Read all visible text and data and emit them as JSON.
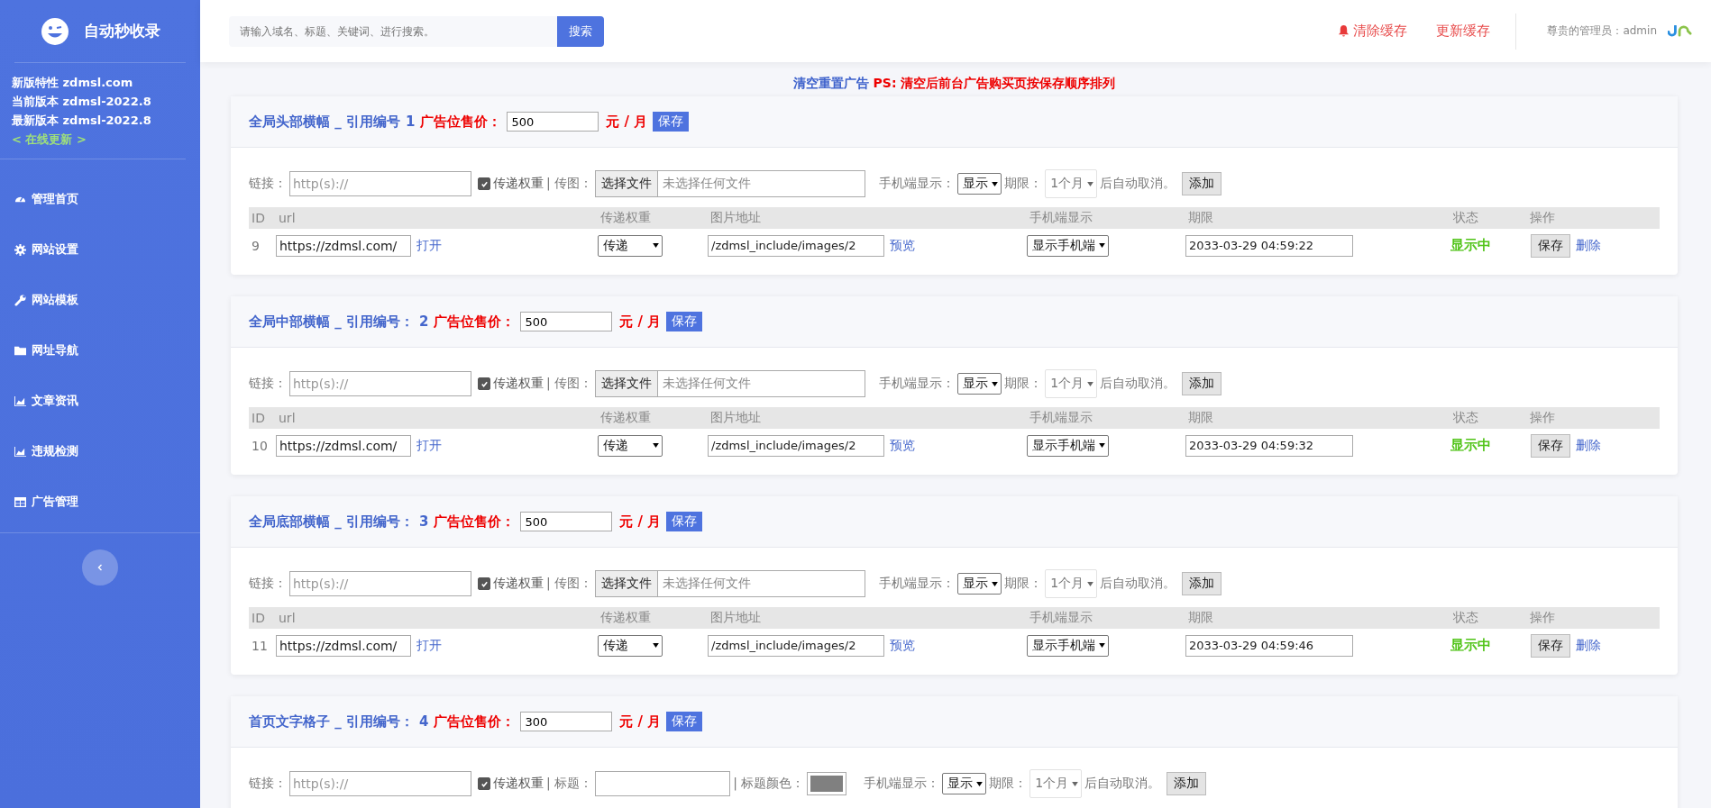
{
  "sidebar": {
    "brand": "自动秒收录",
    "info": [
      "新版特性 zdmsl.com",
      "当前版本 zdmsl-2022.8",
      "最新版本 zdmsl-2022.8"
    ],
    "update_link": "< 在线更新 >",
    "items": [
      {
        "label": "管理首页"
      },
      {
        "label": "网站设置"
      },
      {
        "label": "网站模板"
      },
      {
        "label": "网址导航"
      },
      {
        "label": "文章资讯"
      },
      {
        "label": "违规检测"
      },
      {
        "label": "广告管理"
      }
    ]
  },
  "header": {
    "search_placeholder": "请输入域名、标题、关键词、进行搜索。",
    "search_button": "搜索",
    "actions": [
      "清除缓存",
      "更新缓存"
    ],
    "admin": "尊贵的管理员：admin"
  },
  "notice": {
    "link": "清空重置广告",
    "note": "PS: 清空后前台广告购买页按保存顺序排列"
  },
  "slots": [
    {
      "title": "全局头部横幅 _ 引用编号",
      "ref": "1",
      "price_label": "广告位售价：",
      "price": "500",
      "unit": "元 / 月",
      "save": "保存",
      "form": {
        "kind": "image",
        "link_label": "链接：",
        "link_placeholder": "http(s)://",
        "weight_checked": true,
        "weight_label": "传递权重",
        "image_label": "| 传图：",
        "file_button": "选择文件",
        "file_status": "未选择任何文件",
        "mobile_label": "手机端显示：",
        "mobile_value": "显示",
        "period_label": "期限：",
        "period_value": "1个月",
        "after": "后自动取消。",
        "add": "添加"
      },
      "columns": [
        "ID",
        "url",
        "传递权重",
        "图片地址",
        "手机端显示",
        "期限",
        "状态",
        "操作"
      ],
      "rows": [
        {
          "id": "9",
          "url": "https://zdmsl.com/",
          "open": "打开",
          "weight": "传递",
          "image": "/zdmsl_include/images/2",
          "preview": "预览",
          "mobile": "显示手机端",
          "expires": "2033-03-29 04:59:22",
          "status": "显示中",
          "save": "保存",
          "delete": "删除"
        }
      ]
    },
    {
      "title": "全局中部横幅 _ 引用编号：",
      "ref": "2",
      "price_label": "广告位售价：",
      "price": "500",
      "unit": "元 / 月",
      "save": "保存",
      "form": {
        "kind": "image",
        "link_label": "链接：",
        "link_placeholder": "http(s)://",
        "weight_checked": true,
        "weight_label": "传递权重",
        "image_label": "| 传图：",
        "file_button": "选择文件",
        "file_status": "未选择任何文件",
        "mobile_label": "手机端显示：",
        "mobile_value": "显示",
        "period_label": "期限：",
        "period_value": "1个月",
        "after": "后自动取消。",
        "add": "添加"
      },
      "columns": [
        "ID",
        "url",
        "传递权重",
        "图片地址",
        "手机端显示",
        "期限",
        "状态",
        "操作"
      ],
      "rows": [
        {
          "id": "10",
          "url": "https://zdmsl.com/",
          "open": "打开",
          "weight": "传递",
          "image": "/zdmsl_include/images/2",
          "preview": "预览",
          "mobile": "显示手机端",
          "expires": "2033-03-29 04:59:32",
          "status": "显示中",
          "save": "保存",
          "delete": "删除"
        }
      ]
    },
    {
      "title": "全局底部横幅 _ 引用编号：",
      "ref": "3",
      "price_label": "广告位售价：",
      "price": "500",
      "unit": "元 / 月",
      "save": "保存",
      "form": {
        "kind": "image",
        "link_label": "链接：",
        "link_placeholder": "http(s)://",
        "weight_checked": true,
        "weight_label": "传递权重",
        "image_label": "| 传图：",
        "file_button": "选择文件",
        "file_status": "未选择任何文件",
        "mobile_label": "手机端显示：",
        "mobile_value": "显示",
        "period_label": "期限：",
        "period_value": "1个月",
        "after": "后自动取消。",
        "add": "添加"
      },
      "columns": [
        "ID",
        "url",
        "传递权重",
        "图片地址",
        "手机端显示",
        "期限",
        "状态",
        "操作"
      ],
      "rows": [
        {
          "id": "11",
          "url": "https://zdmsl.com/",
          "open": "打开",
          "weight": "传递",
          "image": "/zdmsl_include/images/2",
          "preview": "预览",
          "mobile": "显示手机端",
          "expires": "2033-03-29 04:59:46",
          "status": "显示中",
          "save": "保存",
          "delete": "删除"
        }
      ]
    },
    {
      "title": "首页文字格子 _ 引用编号：",
      "ref": "4",
      "price_label": "广告位售价：",
      "price": "300",
      "unit": "元 / 月",
      "save": "保存",
      "form": {
        "kind": "text",
        "link_label": "链接：",
        "link_placeholder": "http(s)://",
        "weight_checked": true,
        "weight_label": "传递权重",
        "title_label": "| 标题：",
        "color_label": "| 标题颜色：",
        "color": "#808080",
        "mobile_label": "手机端显示：",
        "mobile_value": "显示",
        "period_label": "期限：",
        "period_value": "1个月",
        "after": "后自动取消。",
        "add": "添加"
      }
    }
  ]
}
